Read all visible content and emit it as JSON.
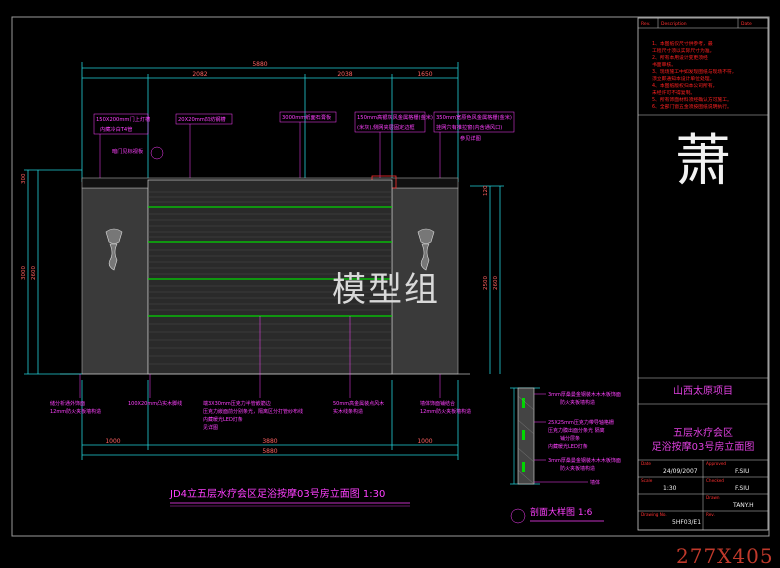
{
  "drawing": {
    "dims_top": [
      "5880",
      "2082",
      "2038",
      "1650"
    ],
    "dims_bottom": [
      "1000",
      "3880",
      "1000",
      "5880"
    ],
    "dims_left": [
      "300",
      "3000",
      "2600"
    ],
    "dims_right": [
      "120",
      "2500",
      "2600"
    ],
    "callouts_top": [
      "150X200mm门上灯槽",
      "内藏冷白T4管",
      "20X20mm凹坊钢槽",
      "3000mm纸面石膏板",
      "150mm高银灰风金属格栅(金米)",
      "350mm宽原色风金属格栅(金米)",
      "(米灰),侧网夹层固定边框",
      "挂网穴有推拉窗(内含通风口)",
      "参见详图",
      "暗门见标视板"
    ],
    "callouts_bottom": [
      "储分析通外饰面",
      "12mm防火夹板墙构造",
      "100X20mm凸实木脚线",
      "端3X30mm压克力半管嵌筋边",
      "压克力嵌面前分别条光，隔离区分打管纱布线",
      "内藏暖光LED灯条",
      "见详图",
      "50mm高金属装点风木",
      "实木线条构造",
      "墙体饰面铺结合",
      "12mm防火夹板墙构造"
    ],
    "main_title": "JD4立五层水疗会区足浴按摩03号房立面图 1:30",
    "section_title": "剖面大样图 1:6",
    "section_labels": [
      "3mm厚桑曼金钢装木木木板饰面",
      "防火夹板墙构造",
      "25X25mm压克力带导轴格栅",
      "压克力膜出面分条光 隔离",
      "铺分层条",
      "内藏暖光LED灯条",
      "3mm厚桑曼金钢装木木木板饰面",
      "防火夹板墙构造",
      "墙体"
    ],
    "watermark": "模型组"
  },
  "title_block": {
    "header": [
      "Rev.",
      "Description",
      "Date"
    ],
    "notes": [
      "1、本图纸仅尺寸供参考，最",
      "工程尺寸须以实际尺寸为准。",
      "2、所有本用设计变更须经",
      "书面审核。",
      "3、现场施工中如发现图纸与现场不符，",
      "须立即通知本设计单位处理。",
      "4、本图纸版权归本公司所有，",
      "未经许可不得复制。",
      "5、所有饰面材料须经确认方可施工。",
      "6、全部门窗五金须按图纸说明执行。"
    ],
    "logo_char": "萧",
    "project": "山西太原项目",
    "drawing_name": [
      "五层水疗会区",
      "足浴按摩03号房立面图"
    ],
    "date_label": "Date",
    "date": "24/09/2007",
    "scale_label": "Scale",
    "scale": "1:30",
    "approved_label": "Approved",
    "approved": "F.SIU",
    "checked_label": "Checked",
    "checked": "F.SIU",
    "drawn_label": "Drawn",
    "drawn": "TANY.H",
    "dwg_label": "Drawing No.",
    "dwg_no": "5HF03/E1",
    "rev_label": "Rev."
  },
  "image_size_label": "277X405",
  "colors": {
    "dim": "#22d0d8",
    "callout": "#ff40ff",
    "panel": "#2a2a2a",
    "slat": "#00d800",
    "note": "#ff2020",
    "project": "#e040e0"
  }
}
